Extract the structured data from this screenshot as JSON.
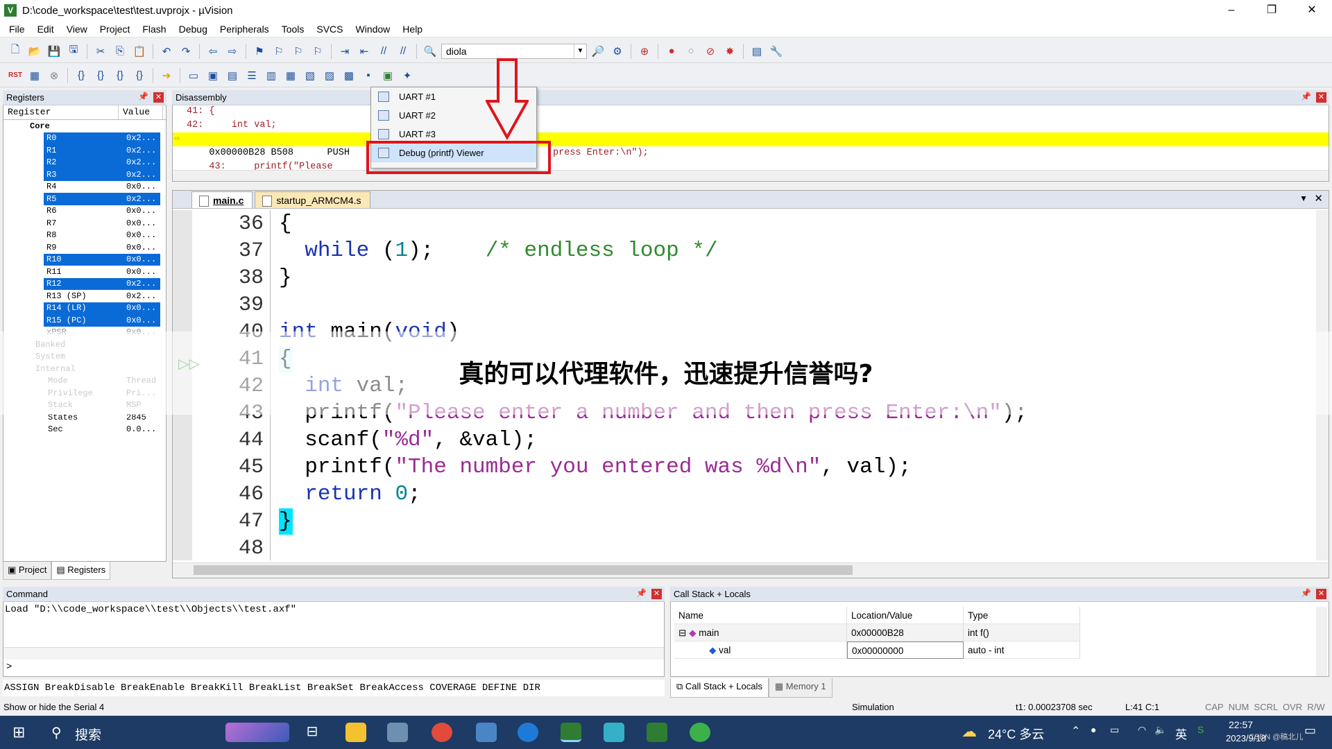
{
  "window": {
    "title": "D:\\code_workspace\\test\\test.uvprojx - µVision",
    "controls": [
      "–",
      "❐",
      "✕"
    ]
  },
  "menu": [
    "File",
    "Edit",
    "View",
    "Project",
    "Flash",
    "Debug",
    "Peripherals",
    "Tools",
    "SVCS",
    "Window",
    "Help"
  ],
  "toolbar": {
    "target_combo": "diola"
  },
  "registers": {
    "title": "Registers",
    "col_register": "Register",
    "col_value": "Value",
    "rows": [
      {
        "name": "Core",
        "value": "",
        "sel": false
      },
      {
        "name": "R0",
        "value": "0x2...",
        "sel": true
      },
      {
        "name": "R1",
        "value": "0x2...",
        "sel": true
      },
      {
        "name": "R2",
        "value": "0x2...",
        "sel": true
      },
      {
        "name": "R3",
        "value": "0x2...",
        "sel": true
      },
      {
        "name": "R4",
        "value": "0x0...",
        "sel": false
      },
      {
        "name": "R5",
        "value": "0x2...",
        "sel": true
      },
      {
        "name": "R6",
        "value": "0x0...",
        "sel": false
      },
      {
        "name": "R7",
        "value": "0x0...",
        "sel": false
      },
      {
        "name": "R8",
        "value": "0x0...",
        "sel": false
      },
      {
        "name": "R9",
        "value": "0x0...",
        "sel": false
      },
      {
        "name": "R10",
        "value": "0x0...",
        "sel": true
      },
      {
        "name": "R11",
        "value": "0x0...",
        "sel": false
      },
      {
        "name": "R12",
        "value": "0x2...",
        "sel": true
      },
      {
        "name": "R13 (SP)",
        "value": "0x2...",
        "sel": false
      },
      {
        "name": "R14 (LR)",
        "value": "0x0...",
        "sel": true
      },
      {
        "name": "R15 (PC)",
        "value": "0x0...",
        "sel": true
      },
      {
        "name": "xPSR",
        "value": "0x0...",
        "sel": false
      },
      {
        "name": "Banked",
        "value": "",
        "sel": false
      },
      {
        "name": "System",
        "value": "",
        "sel": false
      },
      {
        "name": "Internal",
        "value": "",
        "sel": false
      },
      {
        "name": "Mode",
        "value": "Thread",
        "sel": false
      },
      {
        "name": "Privilege",
        "value": "Pri...",
        "sel": false
      },
      {
        "name": "Stack",
        "value": "MSP",
        "sel": false
      },
      {
        "name": "States",
        "value": "2845",
        "sel": false
      },
      {
        "name": "Sec",
        "value": "0.0...",
        "sel": false
      }
    ],
    "tab_project": "Project",
    "tab_registers": "Registers"
  },
  "disassembly": {
    "title": "Disassembly",
    "lines": [
      "41: {",
      "42:     int val;",
      "0x00000B28 B508      PUSH",
      "43:     printf(\"Please"
    ],
    "trail": "press Enter:\\n\");"
  },
  "dropdown": {
    "items": [
      "UART #1",
      "UART #2",
      "UART #3",
      "Debug (printf) Viewer"
    ]
  },
  "editor": {
    "tabs": [
      "main.c",
      "startup_ARMCM4.s"
    ],
    "lines": [
      {
        "num": "36",
        "code": "{"
      },
      {
        "num": "37",
        "code": "  while (1);    /* endless loop */"
      },
      {
        "num": "38",
        "code": "}"
      },
      {
        "num": "39",
        "code": ""
      },
      {
        "num": "40",
        "code": "int main(void)"
      },
      {
        "num": "41",
        "code": "{"
      },
      {
        "num": "42",
        "code": "  int val;"
      },
      {
        "num": "43",
        "code": "  printf(\"Please enter a number and then press Enter:\\n\");"
      },
      {
        "num": "44",
        "code": "  scanf(\"%d\", &val);"
      },
      {
        "num": "45",
        "code": "  printf(\"The number you entered was %d\\n\", val);"
      },
      {
        "num": "46",
        "code": "  return 0;"
      },
      {
        "num": "47",
        "code": "}"
      },
      {
        "num": "48",
        "code": ""
      }
    ]
  },
  "overlay_text": "真的可以代理软件，迅速提升信誉吗?",
  "command": {
    "title": "Command",
    "output": "Load \"D:\\\\code_workspace\\\\test\\\\Objects\\\\test.axf\"",
    "prompt": ">",
    "hint": "ASSIGN BreakDisable BreakEnable BreakKill BreakList BreakSet BreakAccess COVERAGE DEFINE DIR"
  },
  "callstack": {
    "title": "Call Stack + Locals",
    "columns": [
      "Name",
      "Location/Value",
      "Type"
    ],
    "rows": [
      {
        "name": "main",
        "value": "0x00000B28",
        "type": "int f()"
      },
      {
        "name": "val",
        "value": "0x00000000",
        "type": "auto - int"
      }
    ],
    "tab_callstack": "Call Stack + Locals",
    "tab_memory": "Memory 1"
  },
  "status": {
    "left": "Show or hide the Serial 4",
    "mode": "Simulation",
    "time": "t1: 0.00023708 sec",
    "pos": "L:41 C:1",
    "flags": "CAP  NUM  SCRL  OVR  R/W"
  },
  "taskbar": {
    "search": "搜索",
    "weather": "24°C 多云",
    "ime": "英",
    "time": "22:57",
    "date": "2023/9/18",
    "watermark": "CSDN @稿北儿"
  },
  "colors": {
    "accent": "#0a6ad6",
    "highlight": "#ffff00",
    "alert": "#e0141c"
  }
}
